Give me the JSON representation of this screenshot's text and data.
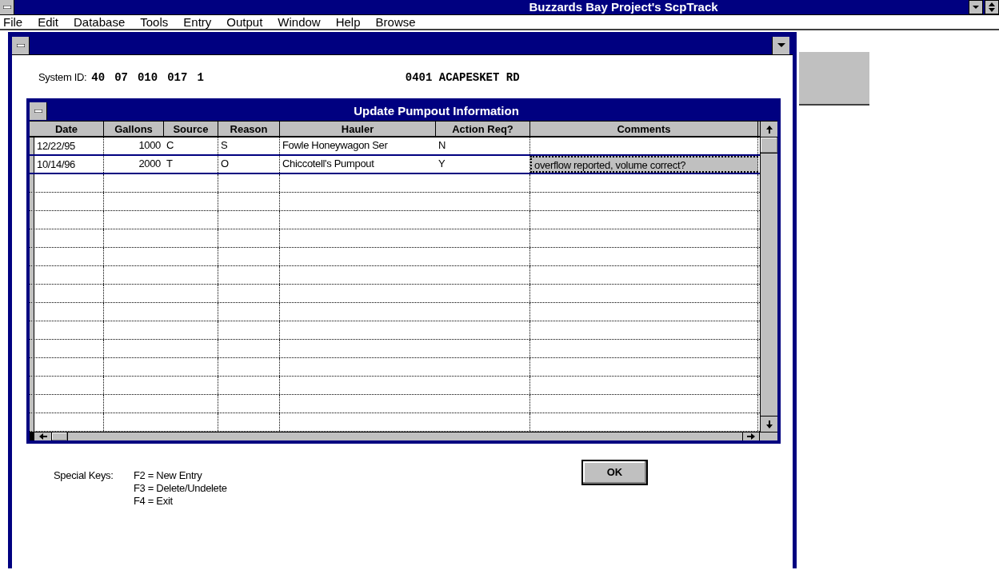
{
  "window": {
    "title": "Buzzards Bay Project's ScpTrack"
  },
  "menu": [
    "File",
    "Edit",
    "Database",
    "Tools",
    "Entry",
    "Output",
    "Window",
    "Help",
    "Browse"
  ],
  "record": {
    "label": "System ID:",
    "ids": [
      "40",
      "07",
      "010",
      "017",
      "1"
    ],
    "address": "0401 ACAPESKET RD"
  },
  "dialog": {
    "title": "Update Pumpout Information",
    "columns": [
      "Date",
      "Gallons",
      "Source",
      "Reason",
      "Hauler",
      "Action Req?",
      "Comments"
    ],
    "rows": [
      {
        "date": "12/22/95",
        "gallons": "1000",
        "source": "C",
        "reason": "S",
        "hauler": "Fowle Honeywagon Ser",
        "action": "N",
        "selected": false
      },
      {
        "date": "10/14/96",
        "gallons": "2000",
        "source": "T",
        "reason": "O",
        "hauler": "Chiccotell's Pumpout",
        "action": "Y",
        "comments": "overflow reported, volume correct?",
        "selected": true
      }
    ]
  },
  "special_keys": {
    "label": "Special Keys:",
    "keys": [
      "F2 = New Entry",
      "F3 = Delete/Undelete",
      "F4 = Exit"
    ]
  },
  "buttons": [
    "OK"
  ]
}
